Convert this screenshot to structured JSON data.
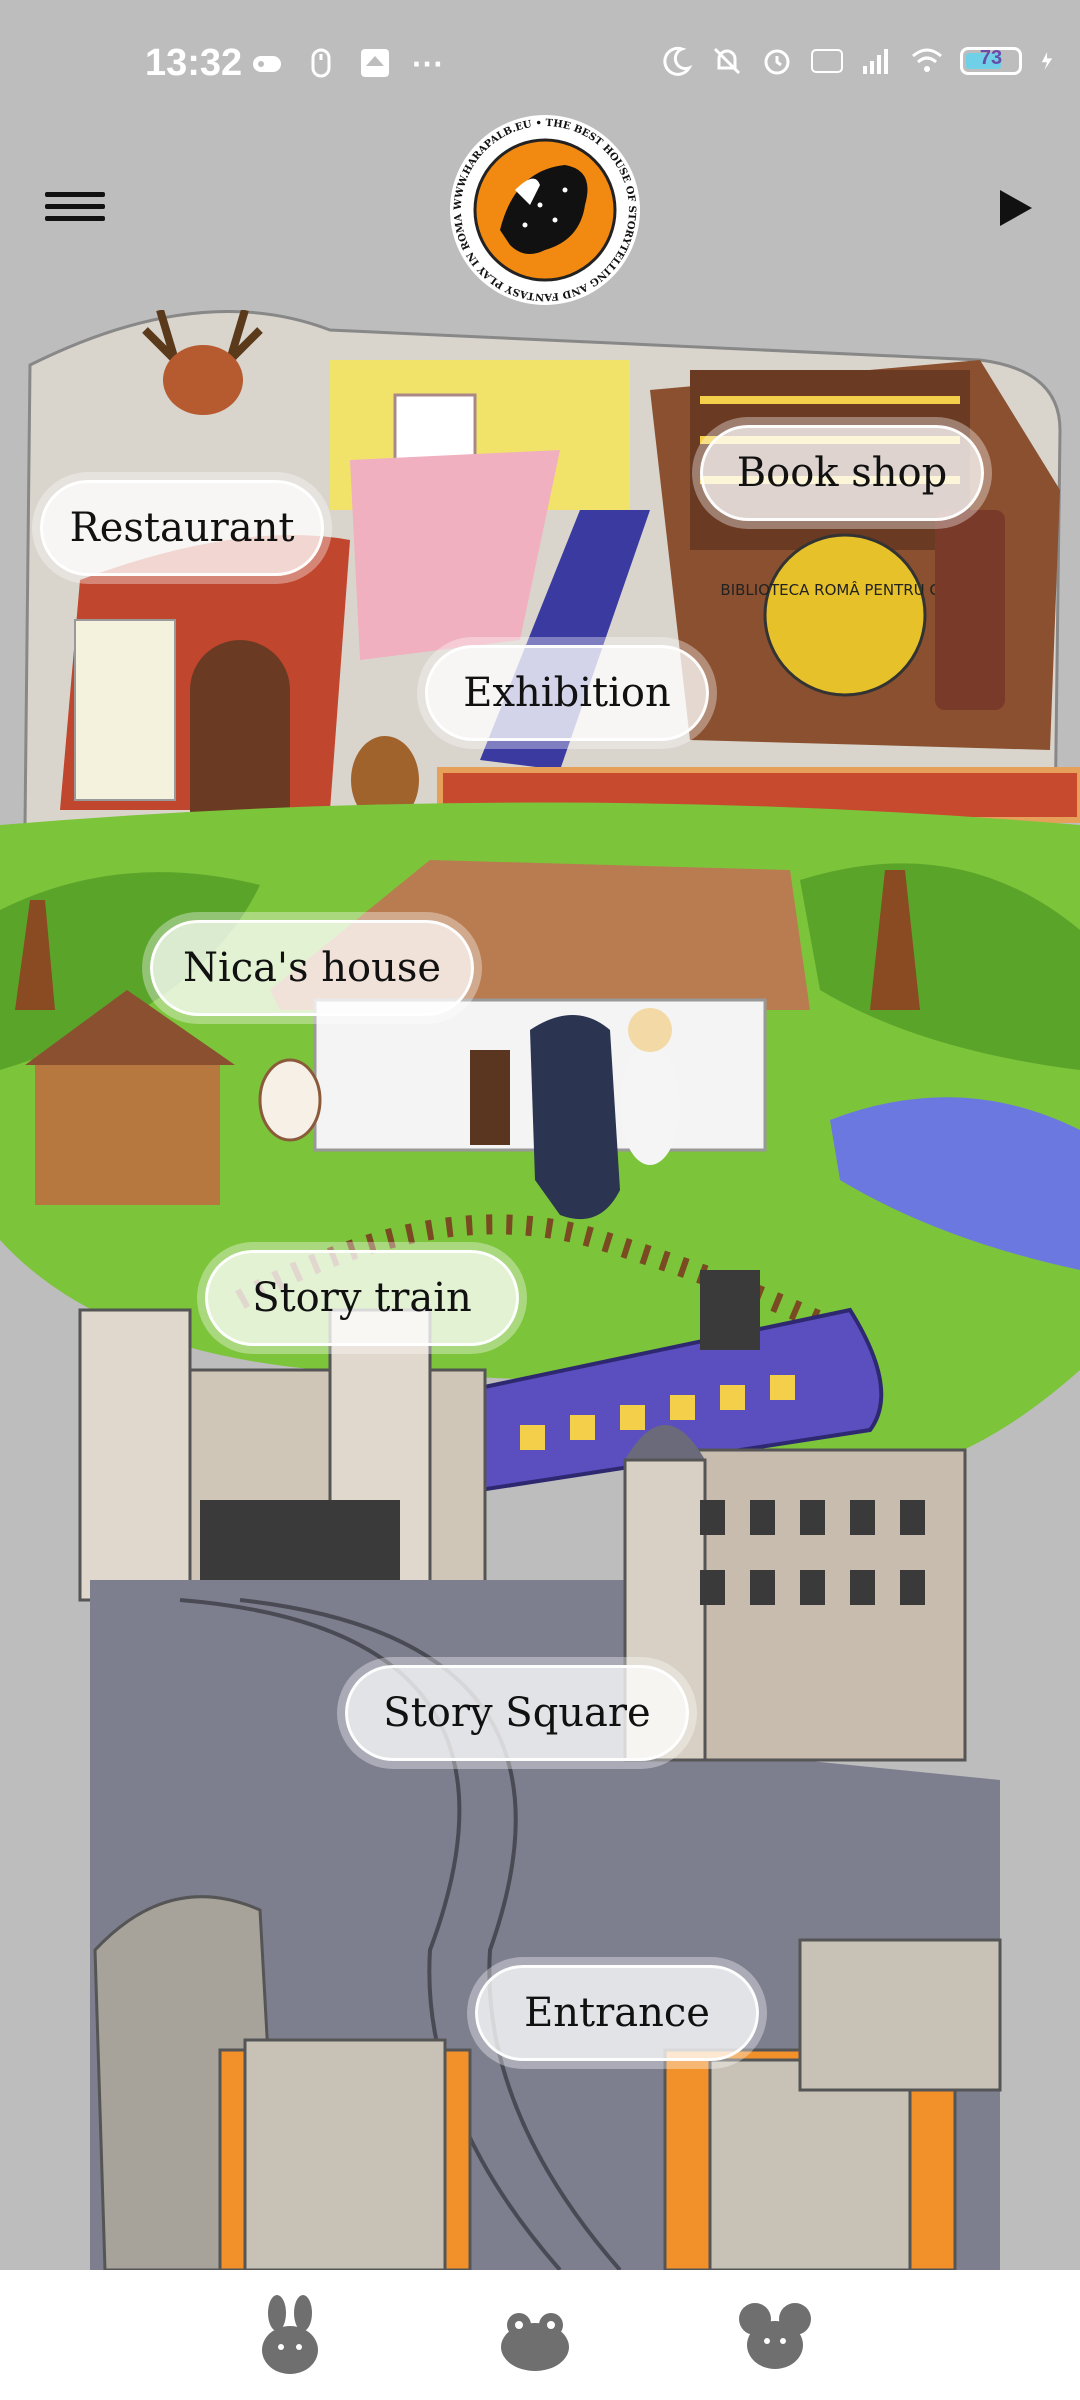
{
  "status_bar": {
    "time": "13:32",
    "more": "···",
    "battery_level": "73",
    "icons": [
      "game-controller-icon",
      "mouse-icon",
      "app-icon",
      "moon-icon",
      "bell-off-icon",
      "alarm-icon",
      "volte-icon",
      "signal-icon",
      "wifi-icon",
      "battery-icon",
      "charging-icon"
    ]
  },
  "app_bar": {
    "menu_icon": "hamburger-menu-icon",
    "play_icon": "play-icon",
    "logo_text": "WWW.HARAPALB.EU • THE BEST HOUSE OF STORYTELLING AND FANTASY PLAY IN ROMANIA"
  },
  "map": {
    "bookstore_sign": "BIBLIOTECA ROMÂ PENTRU COPII",
    "locations": [
      {
        "id": "restaurant",
        "label": "Restaurant"
      },
      {
        "id": "book-shop",
        "label": "Book shop"
      },
      {
        "id": "exhibition",
        "label": "Exhibition"
      },
      {
        "id": "nicas-house",
        "label": "Nica's house"
      },
      {
        "id": "story-train",
        "label": "Story train"
      },
      {
        "id": "story-square",
        "label": "Story Square"
      },
      {
        "id": "entrance",
        "label": "Entrance"
      }
    ]
  },
  "bottom_nav": {
    "items": [
      {
        "icon": "bunny-icon"
      },
      {
        "icon": "frog-icon"
      },
      {
        "icon": "mouse-icon"
      }
    ]
  },
  "colors": {
    "background": "#bdbdbd",
    "grass": "#7cc43a",
    "floor": "#c0462e",
    "train": "#5b4fc0",
    "logo_orange": "#f28a12",
    "water": "#6b78e0"
  }
}
